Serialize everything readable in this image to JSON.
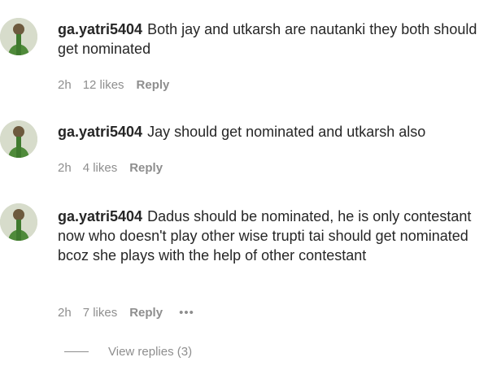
{
  "comments": [
    {
      "username": "ga.yatri5404",
      "text": "Both jay and utkarsh are nautanki they both should get nominated",
      "time": "2h",
      "likes": "12 likes",
      "reply_label": "Reply"
    },
    {
      "username": "ga.yatri5404",
      "text": "Jay should get nominated and utkarsh also",
      "time": "2h",
      "likes": "4 likes",
      "reply_label": "Reply"
    },
    {
      "username": "ga.yatri5404",
      "text": "Dadus should be nominated, he is only contestant now who doesn't play other wise trupti tai should get nominated bcoz she plays with the help of other contestant",
      "time": "2h",
      "likes": "7 likes",
      "reply_label": "Reply",
      "more_label": "•••"
    }
  ],
  "view_replies": "View replies (3)"
}
